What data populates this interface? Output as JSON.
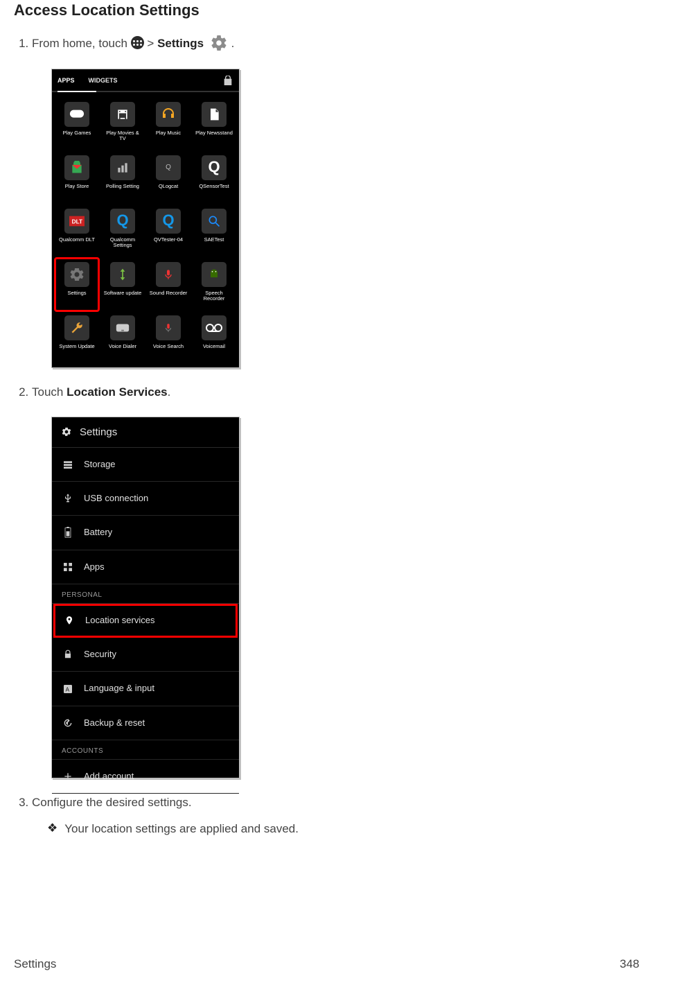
{
  "title": "Access Location Settings",
  "step1": {
    "prefix": "From home, touch ",
    "separator": " > ",
    "settings_word": "Settings",
    "suffix": "."
  },
  "step2": {
    "prefix": "Touch ",
    "bold": "Location Services",
    "suffix": "."
  },
  "step3": "Configure the desired settings.",
  "result": "Your location settings are applied and saved.",
  "diamond": "❖",
  "shot1": {
    "tabs": {
      "apps": "APPS",
      "widgets": "WIDGETS"
    },
    "apps": [
      {
        "label": "Play Games",
        "cls": "green",
        "svg": "gamepad"
      },
      {
        "label": "Play Movies & TV",
        "cls": "red",
        "svg": "film"
      },
      {
        "label": "Play Music",
        "cls": "headphones",
        "svg": "head"
      },
      {
        "label": "Play Newsstand",
        "cls": "docs",
        "svg": "doc"
      },
      {
        "label": "Play Store",
        "cls": "store",
        "svg": "bag"
      },
      {
        "label": "Polling Setting",
        "cls": "dark",
        "svg": "bars"
      },
      {
        "label": "QLogcat",
        "cls": "dark",
        "svg": "qtext"
      },
      {
        "label": "QSensorTest",
        "cls": "blueQ",
        "svg": "Q"
      },
      {
        "label": "Qualcomm DLT",
        "cls": "white",
        "svg": "dolby"
      },
      {
        "label": "Qualcomm Settings",
        "cls": "white",
        "svg": "qblue"
      },
      {
        "label": "QVTester-04",
        "cls": "dark",
        "svg": "qblue"
      },
      {
        "label": "SAETest",
        "cls": "search",
        "svg": "mag"
      },
      {
        "label": "Settings",
        "cls": "white",
        "svg": "gear",
        "highlight": true
      },
      {
        "label": "Software update",
        "cls": "dark",
        "svg": "arrows"
      },
      {
        "label": "Sound Recorder",
        "cls": "redmic",
        "svg": "redmic"
      },
      {
        "label": "Speech Recorder",
        "cls": "android",
        "svg": "droid"
      },
      {
        "label": "System Update",
        "cls": "tools",
        "svg": "wrench"
      },
      {
        "label": "Voice Dialer",
        "cls": "tray",
        "svg": "tray"
      },
      {
        "label": "Voice Search",
        "cls": "mic",
        "svg": "gmic"
      },
      {
        "label": "Voicemail",
        "cls": "tape",
        "svg": "voicemail"
      }
    ]
  },
  "shot2": {
    "header": "Settings",
    "rows_a": [
      {
        "icon": "storage",
        "label": "Storage"
      },
      {
        "icon": "usb",
        "label": "USB connection"
      },
      {
        "icon": "battery",
        "label": "Battery"
      },
      {
        "icon": "apps",
        "label": "Apps"
      }
    ],
    "section_personal": "PERSONAL",
    "rows_b": [
      {
        "icon": "location",
        "label": "Location services",
        "highlight": true
      },
      {
        "icon": "lock",
        "label": "Security"
      },
      {
        "icon": "lang",
        "label": "Language & input"
      },
      {
        "icon": "backup",
        "label": "Backup & reset"
      }
    ],
    "section_accounts": "ACCOUNTS",
    "rows_c": [
      {
        "icon": "plus",
        "label": "Add account"
      }
    ]
  },
  "footer": {
    "section": "Settings",
    "page": "348"
  }
}
